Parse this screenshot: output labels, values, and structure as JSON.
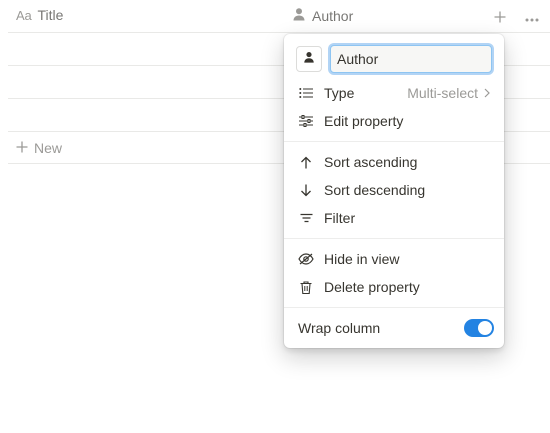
{
  "table": {
    "title_header": {
      "icon": "text-aa-icon",
      "icon_text": "Aa",
      "label": "Title"
    },
    "author_header": {
      "icon": "person-icon",
      "label": "Author"
    },
    "add_icon": "plus-icon",
    "more_icon": "more-horizontal-icon",
    "new_label": "New"
  },
  "menu": {
    "name_value": "Author",
    "type_label": "Type",
    "type_value": "Multi-select",
    "edit_label": "Edit property",
    "sort_asc_label": "Sort ascending",
    "sort_desc_label": "Sort descending",
    "filter_label": "Filter",
    "hide_label": "Hide in view",
    "delete_label": "Delete property",
    "wrap_label": "Wrap column",
    "wrap_enabled": true
  },
  "colors": {
    "accent": "#2383e2",
    "text": "#37352f",
    "muted": "#9b9a97"
  }
}
